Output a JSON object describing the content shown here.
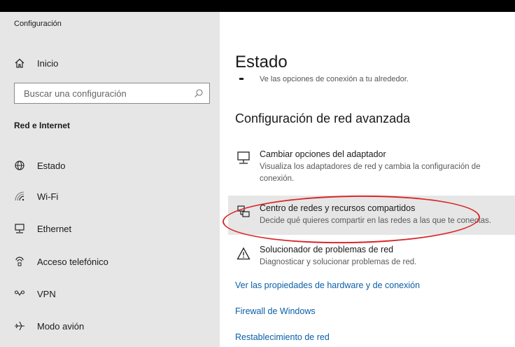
{
  "window": {
    "title": "Configuración"
  },
  "sidebar": {
    "home_label": "Inicio",
    "search_placeholder": "Buscar una configuración",
    "section_title": "Red e Internet",
    "items": [
      {
        "label": "Estado",
        "icon": "globe-icon"
      },
      {
        "label": "Wi-Fi",
        "icon": "wifi-icon"
      },
      {
        "label": "Ethernet",
        "icon": "ethernet-icon"
      },
      {
        "label": "Acceso telefónico",
        "icon": "dialup-icon"
      },
      {
        "label": "VPN",
        "icon": "vpn-icon"
      },
      {
        "label": "Modo avión",
        "icon": "airplane-icon"
      }
    ]
  },
  "main": {
    "title": "Estado",
    "subtitle": "Ve las opciones de conexión a tu alrededor.",
    "advanced_title": "Configuración de red avanzada",
    "options": [
      {
        "title": "Cambiar opciones del adaptador",
        "desc": "Visualiza los adaptadores de red y cambia la configuración de conexión.",
        "icon": "adapter-icon"
      },
      {
        "title": "Centro de redes y recursos compartidos",
        "desc": "Decide qué quieres compartir en las redes a las que te conectas.",
        "icon": "network-sharing-icon"
      },
      {
        "title": "Solucionador de problemas de red",
        "desc": "Diagnosticar y solucionar problemas de red.",
        "icon": "warning-icon"
      }
    ],
    "links": [
      "Ver las propiedades de hardware y de conexión",
      "Firewall de Windows",
      "Restablecimiento de red"
    ]
  },
  "colors": {
    "accent_link": "#0a5fa8",
    "annotation": "#d8282a",
    "sidebar_bg": "#e6e6e6"
  }
}
